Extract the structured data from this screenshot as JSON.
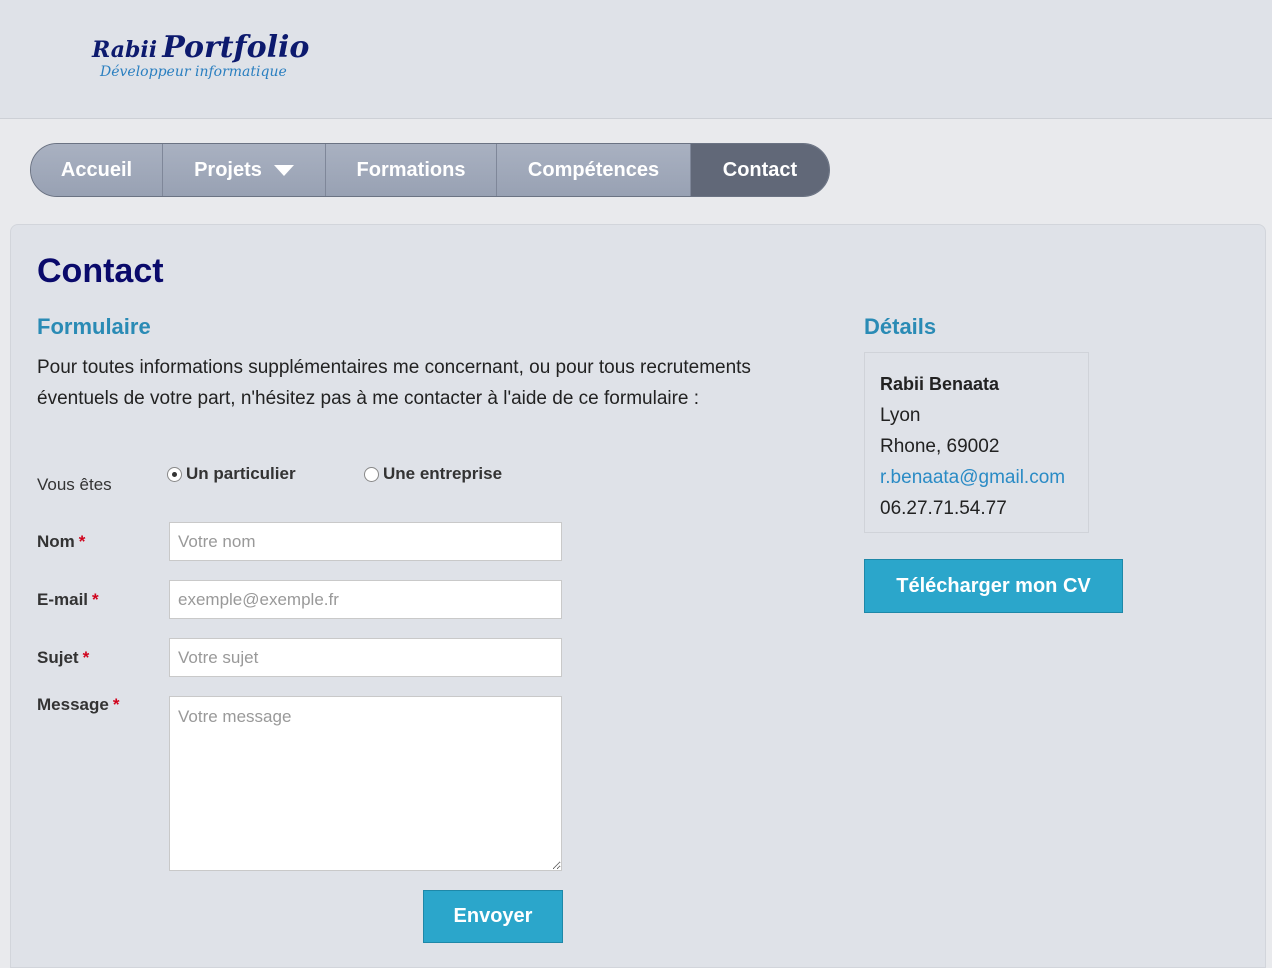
{
  "header": {
    "logo_small": "Rabii",
    "logo_big": "Portfolio",
    "logo_subtitle": "Développeur informatique"
  },
  "nav": {
    "items": [
      {
        "label": "Accueil"
      },
      {
        "label": "Projets"
      },
      {
        "label": "Formations"
      },
      {
        "label": "Compétences"
      },
      {
        "label": "Contact"
      }
    ],
    "active": "Contact"
  },
  "page": {
    "title": "Contact"
  },
  "form": {
    "heading": "Formulaire",
    "intro": "Pour toutes informations supplémentaires me concernant, ou pour tous recrutements éventuels de votre part, n'hésitez pas à me contacter à l'aide de ce formulaire :",
    "type_label": "Vous êtes",
    "type_options": [
      "Un particulier",
      "Une entreprise"
    ],
    "type_selected": "Un particulier",
    "required_mark": "*",
    "nom_label": "Nom",
    "nom_placeholder": "Votre nom",
    "email_label": "E-mail",
    "email_placeholder": "exemple@exemple.fr",
    "sujet_label": "Sujet",
    "sujet_placeholder": "Votre sujet",
    "message_label": "Message",
    "message_placeholder": "Votre message",
    "submit_label": "Envoyer"
  },
  "details": {
    "heading": "Détails",
    "name": "Rabii Benaata",
    "city": "Lyon",
    "region": "Rhone, 69002",
    "email": "r.benaata@gmail.com",
    "phone": "06.27.71.54.77",
    "cv_button": "Télécharger mon CV"
  },
  "colors": {
    "accent": "#2ba6cb",
    "heading": "#2a8bb5",
    "title": "#0a0a6b",
    "nav_active": "#616878"
  }
}
